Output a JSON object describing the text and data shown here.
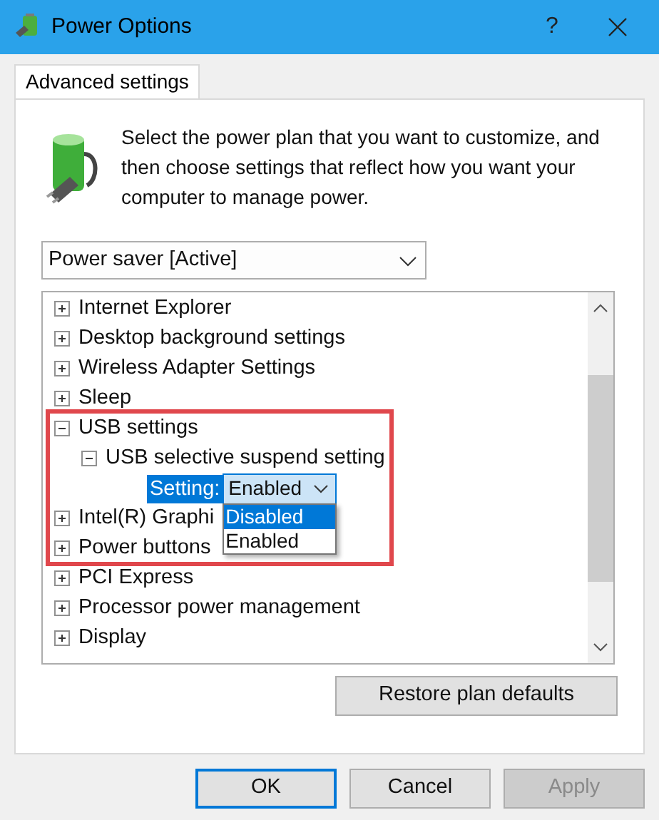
{
  "window": {
    "title": "Power Options",
    "help": "?"
  },
  "tabs": [
    {
      "label": "Advanced settings",
      "selected": true
    }
  ],
  "intro": "Select the power plan that you want to customize, and then choose settings that reflect how you want your computer to manage power.",
  "plan_select": {
    "value": "Power saver [Active]"
  },
  "tree": [
    {
      "label": "Internet Explorer",
      "expanded": false
    },
    {
      "label": "Desktop background settings",
      "expanded": false
    },
    {
      "label": "Wireless Adapter Settings",
      "expanded": false
    },
    {
      "label": "Sleep",
      "expanded": false
    },
    {
      "label": "USB settings",
      "expanded": true,
      "children": [
        {
          "label": "USB selective suspend setting",
          "expanded": true,
          "setting": {
            "label": "Setting:",
            "value": "Enabled",
            "options": [
              {
                "label": "Disabled",
                "highlighted": true
              },
              {
                "label": "Enabled",
                "highlighted": false
              }
            ]
          }
        }
      ]
    },
    {
      "label": "Intel(R) Graphi",
      "expanded": false
    },
    {
      "label": "Power buttons",
      "expanded": false
    },
    {
      "label": "PCI Express",
      "expanded": false
    },
    {
      "label": "Processor power management",
      "expanded": false
    },
    {
      "label": "Display",
      "expanded": false
    }
  ],
  "restore_button": "Restore plan defaults",
  "buttons": [
    {
      "label": "OK",
      "disabled": false,
      "default": true
    },
    {
      "label": "Cancel",
      "disabled": false,
      "default": false
    },
    {
      "label": "Apply",
      "disabled": true,
      "default": false
    }
  ]
}
